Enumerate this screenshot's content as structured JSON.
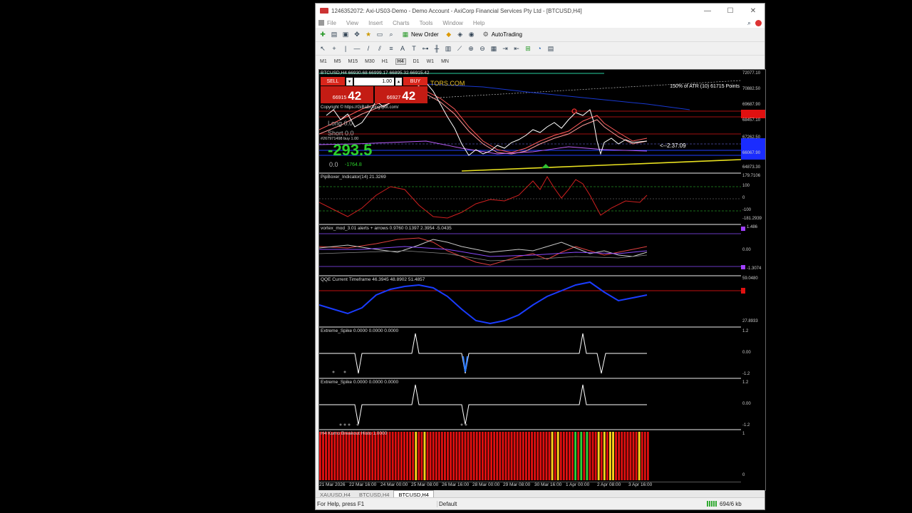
{
  "window": {
    "title": "1246352072: Axi-US03-Demo - Demo Account - AxiCorp Financial Services Pty Ltd - [BTCUSD,H4]",
    "minimize": "—",
    "maximize": "☐",
    "close": "✕"
  },
  "menu": [
    "File",
    "View",
    "Insert",
    "Charts",
    "Tools",
    "Window",
    "Help"
  ],
  "toolbar": {
    "new_order": "New Order",
    "autotrading": "AutoTrading"
  },
  "timeframes": [
    "M1",
    "M5",
    "M15",
    "M30",
    "H1",
    "H4",
    "D1",
    "W1",
    "MN"
  ],
  "active_timeframe": "H4",
  "chart": {
    "header": "BTCUSD,H4  66930.68 66999.17 66895.32 66915.42",
    "watermark": "TORS.COM",
    "copyright": "Copyright © https://GiBaBr.blogspot.com/",
    "atr_note": "150% of ATR (10) 61715 Points",
    "timer": "<--2:37:09",
    "long_label": "Long",
    "long_val": "0.0",
    "short_label": "Short",
    "short_val": "0.0",
    "order_note": "#267971498 buy 1.00",
    "pnl": "-293.5",
    "pnl_small_left": "0.0",
    "pnl_small_right": "-1764.8",
    "price_scale": [
      "72077.10",
      "70882.50",
      "69687.90",
      "68457.10",
      "67262.50",
      "66067.90",
      "64873.30"
    ]
  },
  "trade": {
    "sell": "SELL",
    "buy": "BUY",
    "lot": "1.00",
    "sell_small": "66915",
    "sell_big": "42",
    "buy_small": "66927",
    "buy_big": "42"
  },
  "panes": [
    {
      "label": "PipBoxer_Indicator(14) 21.3269",
      "scale": [
        "179.7106",
        "100",
        "0",
        "-100",
        "-181.2939"
      ]
    },
    {
      "label": "vortex_mod_3.01 alerts + arrows 0.9760 0.1397 2.3954 -5.0435",
      "scale": [
        "1.486",
        "0.00",
        "-1.3074"
      ]
    },
    {
      "label": "QQE Current Timeframe 46.3945 48.8902 51.4857",
      "scale": [
        "59.0480",
        "27.8933"
      ]
    },
    {
      "label": "Extreme_Spike 0.0000 0.0000 0.0000",
      "scale": [
        "1.2",
        "0.00",
        "-1.2"
      ]
    },
    {
      "label": "Extreme_Spike 0.0000 0.0000 0.0000",
      "scale": [
        "1.2",
        "0.00",
        "-1.2"
      ]
    },
    {
      "label": "H4 Kumo Breakout Histo 1.0000",
      "scale": [
        "1",
        "0"
      ]
    }
  ],
  "xaxis": [
    "21 Mar 2026",
    "22 Mar 16:00",
    "24 Mar 00:00",
    "25 Mar 08:00",
    "26 Mar 16:00",
    "28 Mar 00:00",
    "29 Mar 08:00",
    "30 Mar 16:00",
    "1 Apr 00:00",
    "2 Apr 08:00",
    "3 Apr 16:00"
  ],
  "tabs": [
    "XAUUSD,H4",
    "BTCUSD,H4",
    "BTCUSD,H4"
  ],
  "active_tab": 2,
  "status": {
    "help": "For Help, press F1",
    "profile": "Default",
    "traffic": "694/6 kb"
  },
  "colors": {
    "sell": "#d9251b",
    "candles": "#ffffff",
    "ma": "#ff6a6a",
    "qqe": "#1a3cff",
    "histo_red": "#e01010",
    "histo_yellow": "#ffd21a",
    "histo_green": "#2fd03a"
  }
}
